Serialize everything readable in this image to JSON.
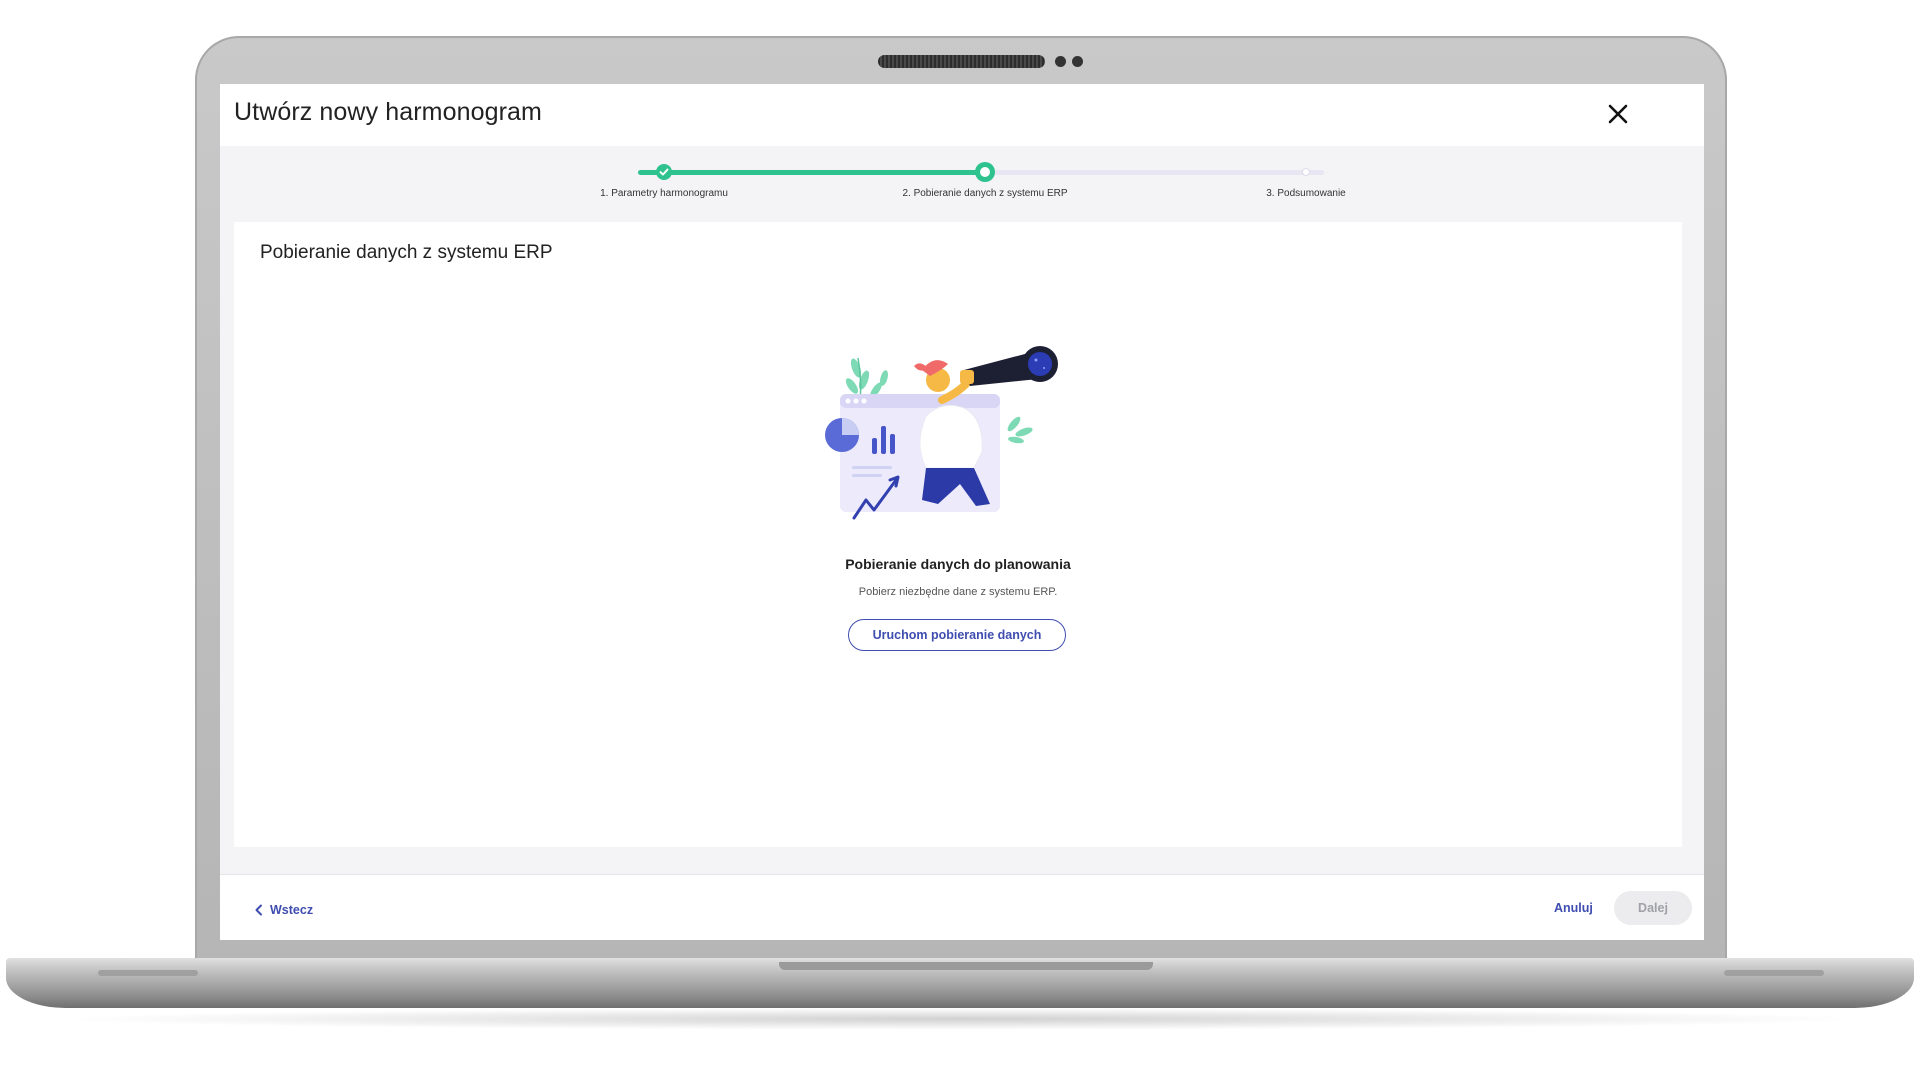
{
  "dialog": {
    "title": "Utwórz nowy harmonogram",
    "close_icon": "close-icon"
  },
  "stepper": {
    "current_step": 2,
    "steps": [
      {
        "label": "1. Parametry harmonogramu",
        "state": "done"
      },
      {
        "label": "2. Pobieranie danych z systemu ERP",
        "state": "active"
      },
      {
        "label": "3. Podsumowanie",
        "state": "todo"
      }
    ],
    "accent_color": "#2ec28e"
  },
  "card": {
    "title": "Pobieranie danych z systemu ERP",
    "illustration": "person-with-telescope-illustration",
    "empty_state_title": "Pobieranie danych do planowania",
    "empty_state_text": "Pobierz niezbędne dane z systemu ERP.",
    "action_label": "Uruchom pobieranie danych"
  },
  "footer": {
    "back_label": "Wstecz",
    "cancel_label": "Anuluj",
    "next_label": "Dalej",
    "next_enabled": false
  },
  "colors": {
    "primary": "#3f4db0",
    "success": "#2ec28e"
  }
}
